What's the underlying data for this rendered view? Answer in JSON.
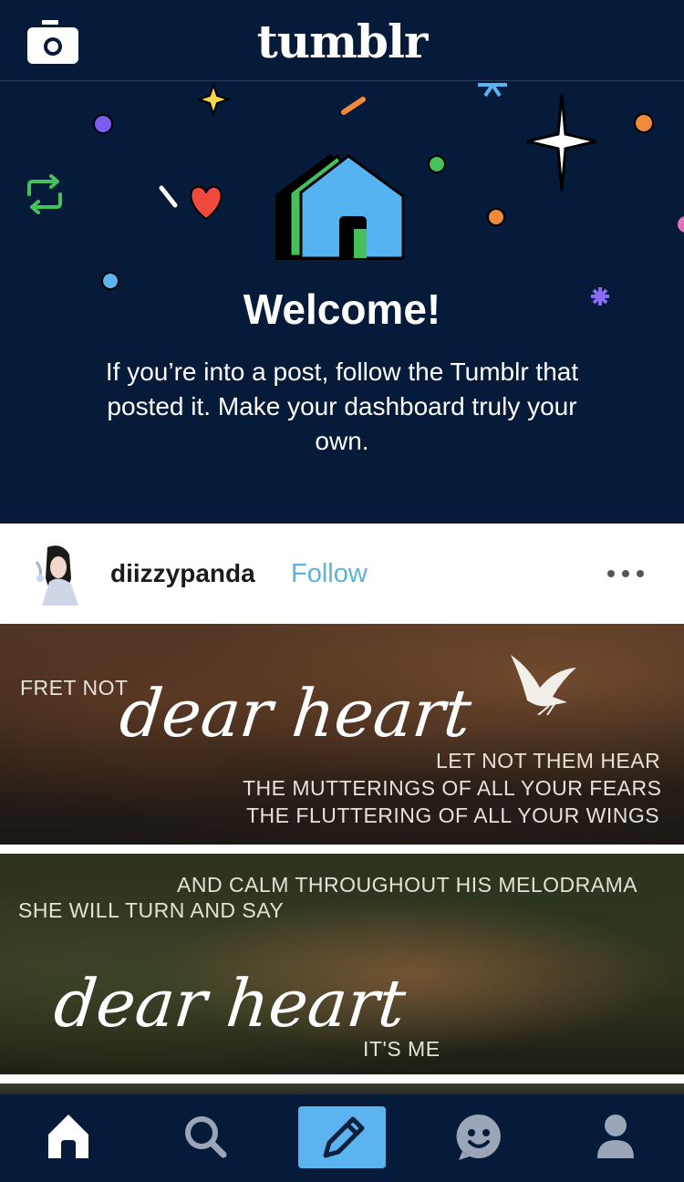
{
  "app": {
    "logo_text": "tumblr"
  },
  "header": {
    "camera_icon": "camera-icon"
  },
  "welcome": {
    "title": "Welcome!",
    "message": "If you’re into a post, follow the Tumblr that posted it. Make your dashboard truly your own.",
    "colors": {
      "house_blue": "#55b3f2",
      "house_green": "#46c05a",
      "heart_red": "#f04a3f",
      "accent_orange": "#f08a3a",
      "accent_purple": "#7b5cf0"
    }
  },
  "post": {
    "username": "diizzypanda",
    "follow_label": "Follow",
    "more_icon": "more-horizontal-icon",
    "image1": {
      "line1": "FRET NOT",
      "script": "dear heart",
      "line2": "LET NOT THEM HEAR",
      "line3": "THE MUTTERINGS OF ALL YOUR FEARS",
      "line4": "THE FLUTTERING OF ALL YOUR WINGS"
    },
    "image2": {
      "line1": "AND CALM THROUGHOUT HIS MELODRAMA",
      "line2": "SHE WILL TURN AND SAY",
      "script": "dear heart",
      "line3": "IT'S ME"
    }
  },
  "nav": {
    "items": [
      {
        "name": "home",
        "icon": "home-icon",
        "active": true
      },
      {
        "name": "search",
        "icon": "search-icon",
        "active": false
      },
      {
        "name": "compose",
        "icon": "pencil-icon",
        "active": false
      },
      {
        "name": "activity",
        "icon": "smiley-icon",
        "active": false
      },
      {
        "name": "account",
        "icon": "person-icon",
        "active": false
      }
    ],
    "compose_color": "#5bb4f0"
  }
}
